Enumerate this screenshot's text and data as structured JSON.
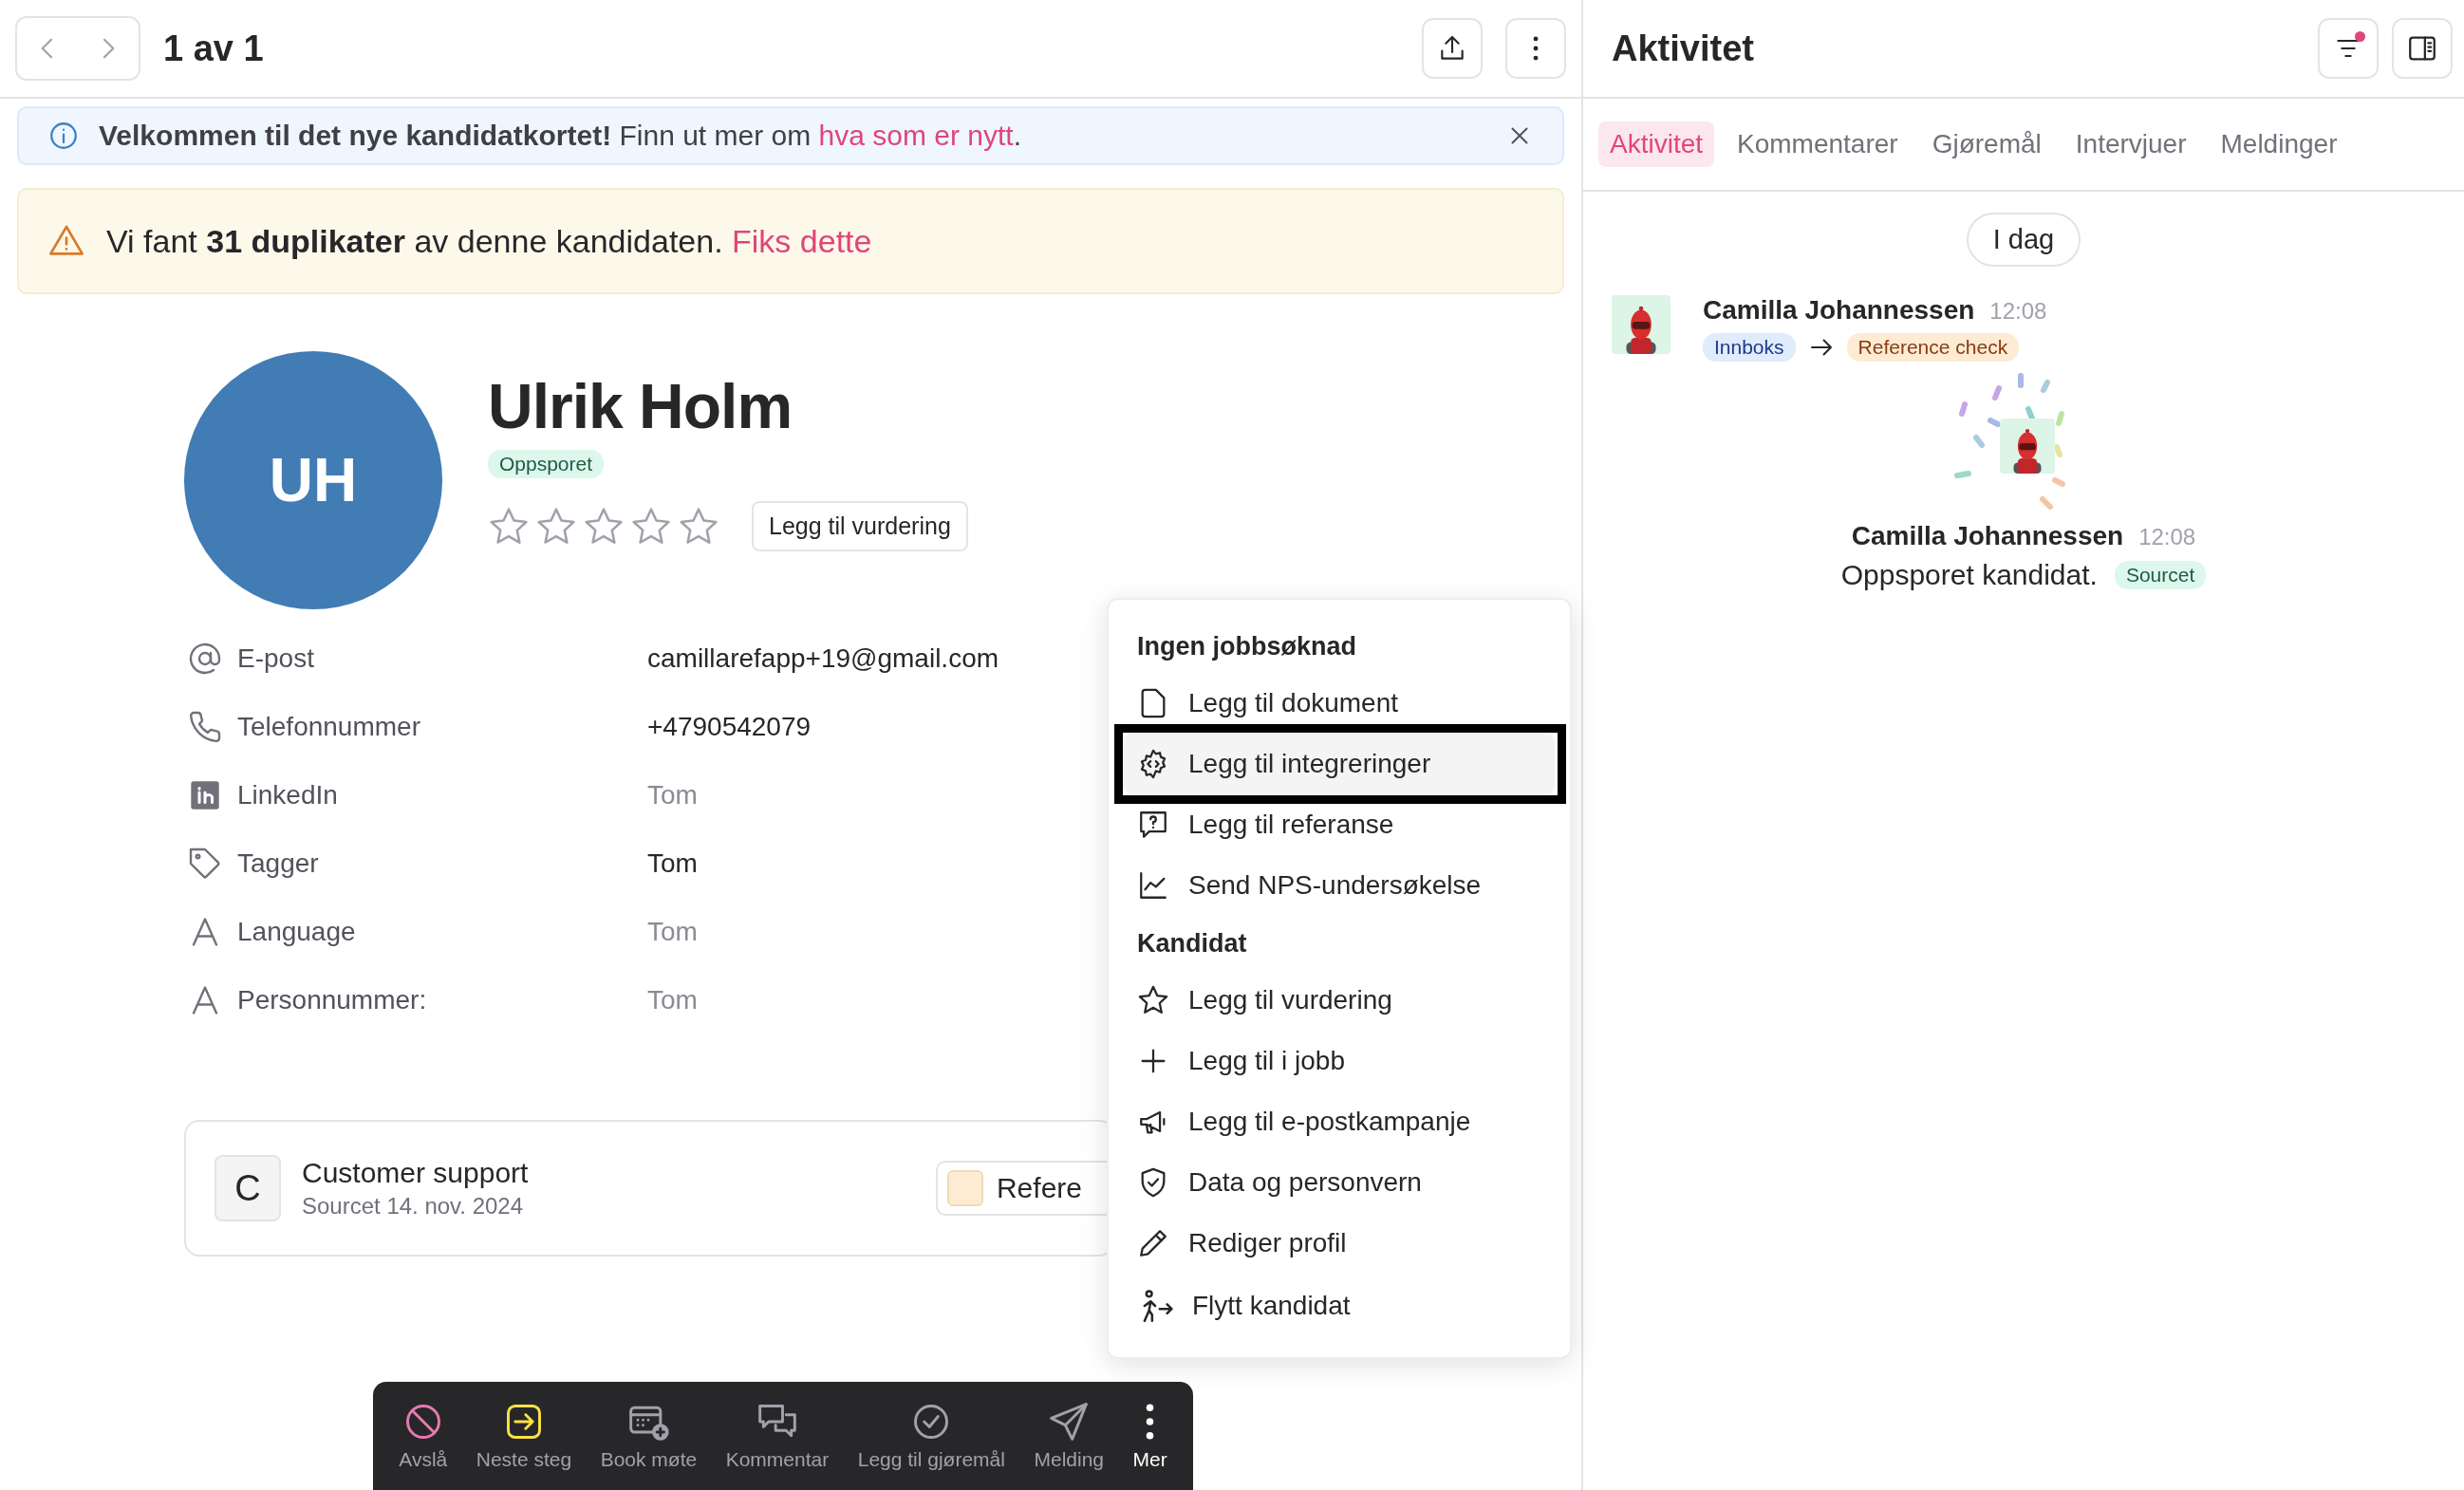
{
  "header": {
    "pager": "1 av 1"
  },
  "info_banner": {
    "text": "**Velkommen til det nye kandidatkortet!** Finn ut mer om ",
    "link": "hva som er nytt",
    "after": "."
  },
  "warning_banner": {
    "text": "Vi fant **31 duplikater** av denne kandidaten.",
    "link": "Fiks dette"
  },
  "profile": {
    "initials": "UH",
    "name": "Ulrik Holm",
    "status": "Oppsporet",
    "stars": 0,
    "rating_button": "Legg til vurdering"
  },
  "fields": [
    {
      "label": "E-post",
      "value": "camillarefapp+19@gmail.com",
      "muted": false
    },
    {
      "label": "Telefonnummer",
      "value": "+4790542079",
      "muted": false
    },
    {
      "label": "LinkedIn",
      "value": "Tom",
      "muted": true
    },
    {
      "label": "Tagger",
      "value": "Tom",
      "muted": false
    },
    {
      "label": "Language",
      "value": "Tom",
      "muted": true
    },
    {
      "label": "Personnummer:",
      "value": "Tom",
      "muted": true
    }
  ],
  "application_card": {
    "initial": "C",
    "title": "Customer support",
    "subtitle": "Sourcet 14. nov. 2024",
    "stage_button": "Refere"
  },
  "menu": {
    "sections": [
      {
        "title": "Ingen jobbsøknad",
        "items": [
          {
            "label": "Legg til dokument",
            "selected": false
          },
          {
            "label": "Legg til integreringer",
            "selected": true
          },
          {
            "label": "Legg til referanse",
            "selected": false
          },
          {
            "label": "Send NPS-undersøkelse",
            "selected": false
          }
        ]
      },
      {
        "title": "Kandidat",
        "items": [
          {
            "label": "Legg til vurdering",
            "selected": false
          },
          {
            "label": "Legg til i jobb",
            "selected": false
          },
          {
            "label": "Legg til e-postkampanje",
            "selected": false
          },
          {
            "label": "Data og personvern",
            "selected": false
          },
          {
            "label": "Rediger profil",
            "selected": false
          },
          {
            "label": "Flytt kandidat",
            "selected": false
          }
        ]
      }
    ]
  },
  "action_bar": [
    {
      "label": "Avslå",
      "selected": false
    },
    {
      "label": "Neste steg",
      "selected": false
    },
    {
      "label": "Book møte",
      "selected": false
    },
    {
      "label": "Kommentar",
      "selected": false
    },
    {
      "label": "Legg til gjøremål",
      "selected": false
    },
    {
      "label": "Melding",
      "selected": false
    },
    {
      "label": "Mer",
      "selected": true
    }
  ],
  "activity_panel": {
    "title": "Aktivitet",
    "filter_active": true,
    "tabs": [
      {
        "label": "Aktivitet",
        "selected": true
      },
      {
        "label": "Kommentarer",
        "selected": false
      },
      {
        "label": "Gjøremål",
        "selected": false
      },
      {
        "label": "Intervjuer",
        "selected": false
      },
      {
        "label": "Meldinger",
        "selected": false
      }
    ],
    "date": "I dag",
    "events": [
      {
        "kind": "stage_change",
        "actor": "Camilla Johannessen",
        "time": "12:08",
        "from": "Innboks",
        "to": "Reference check"
      },
      {
        "kind": "sourced",
        "actor": "Camilla Johannessen",
        "time": "12:08",
        "text": "Oppsporet kandidat.",
        "badge": "Sourcet"
      }
    ]
  }
}
